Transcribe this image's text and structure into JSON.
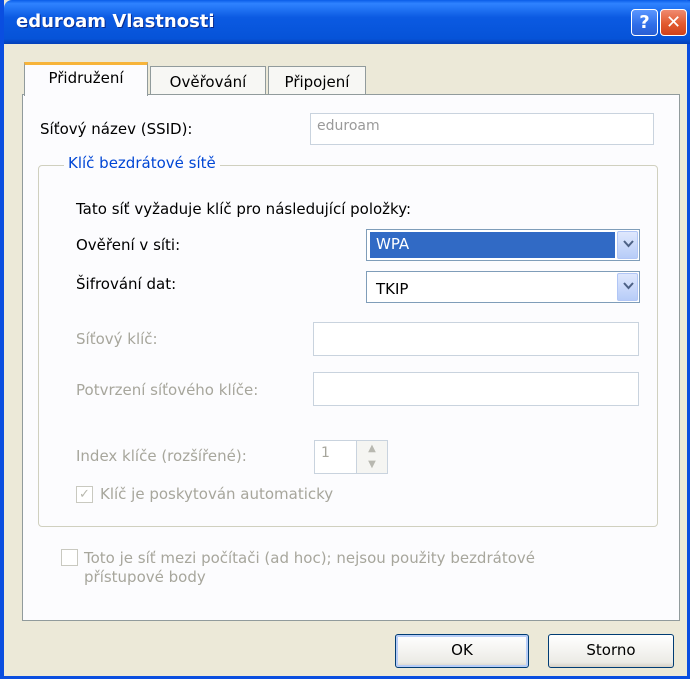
{
  "window": {
    "title": "eduroam Vlastnosti"
  },
  "titlebar": {
    "help_label": "?",
    "close_label": "✕"
  },
  "tabs": [
    {
      "label": "Přidružení",
      "active": true
    },
    {
      "label": "Ověřování",
      "active": false
    },
    {
      "label": "Připojení",
      "active": false
    }
  ],
  "ssid": {
    "label": "Síťový název (SSID):",
    "value": "eduroam"
  },
  "wireless_key": {
    "legend": "Klíč bezdrátové sítě",
    "intro": "Tato síť vyžaduje klíč pro následující položky:",
    "auth_label": "Ověření v síti:",
    "auth_value": "WPA",
    "encryption_label": "Šifrování dat:",
    "encryption_value": "TKIP",
    "network_key_label": "Síťový klíč:",
    "network_key_value": "",
    "confirm_key_label": "Potvrzení síťového klíče:",
    "confirm_key_value": "",
    "key_index_label": "Index klíče (rozšířené):",
    "key_index_value": "1",
    "auto_key_label": "Klíč je poskytován automaticky",
    "auto_key_checked": true
  },
  "adhoc": {
    "label_line1": "Toto je síť mezi počítači (ad hoc); nejsou použity bezdrátové",
    "label_line2": "přístupové body",
    "checked": false
  },
  "buttons": {
    "ok": "OK",
    "cancel": "Storno"
  },
  "colors": {
    "titlebar": "#0653d8",
    "accent_tab": "#f7b43a",
    "legend": "#0046d5",
    "selection": "#316ac5"
  }
}
